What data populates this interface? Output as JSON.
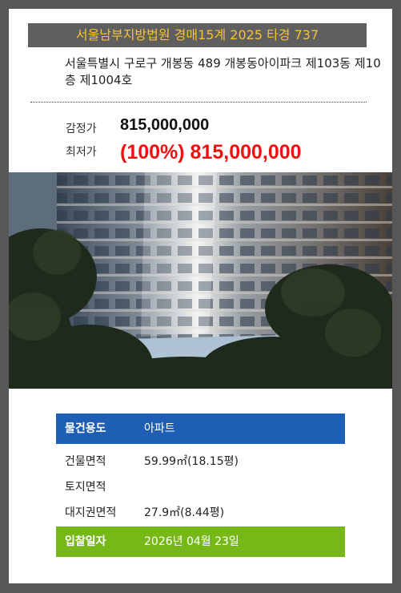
{
  "court_title": "서울남부지방법원 경매15계 2025 타경 737",
  "address": "서울특별시 구로구 개봉동 489 개봉동아이파크 제103동 제10층 제1004호",
  "prices": {
    "appraisal_label": "감정가",
    "appraisal_value": "815,000,000",
    "minimum_label": "최저가",
    "minimum_value": "(100%) 815,000,000"
  },
  "property_photo": "apartment-building-photo",
  "details": {
    "usage_label": "물건용도",
    "usage_value": "아파트",
    "building_area_label": "건물면적",
    "building_area_value": "59.99㎡(18.15평)",
    "land_area_label": "토지면적",
    "land_area_value": "",
    "land_right_label": "대지권면적",
    "land_right_value": "27.9㎡(8.44평)",
    "bid_date_label": "입찰일자",
    "bid_date_value": "2026년 04월 23일"
  },
  "colors": {
    "background": "#575757",
    "banner_bg": "#5f5f5f",
    "banner_text": "#f6c232",
    "minimum_price": "#ee1111",
    "usage_row": "#1e5fb4",
    "bid_row": "#77b819"
  }
}
